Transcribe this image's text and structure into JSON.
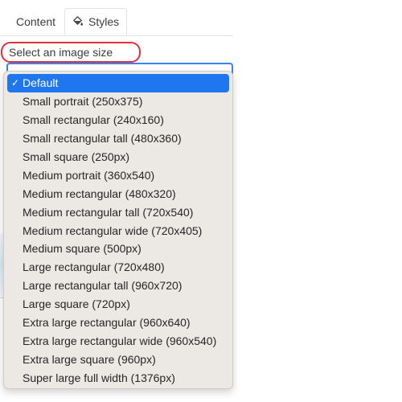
{
  "tabs": [
    {
      "label": "Content",
      "active": false
    },
    {
      "label": "Styles",
      "active": true,
      "icon": "paint-bucket-icon"
    }
  ],
  "field": {
    "label": "Select an image size",
    "highlight_color": "#e0303a"
  },
  "dropdown": {
    "selected_index": 0,
    "check_glyph": "✓",
    "selected_color": "#1f77f0",
    "options": [
      "Default",
      "Small portrait (250x375)",
      "Small rectangular (240x160)",
      "Small rectangular tall (480x360)",
      "Small square (250px)",
      "Medium portrait (360x540)",
      "Medium rectangular (480x320)",
      "Medium rectangular tall (720x540)",
      "Medium rectangular wide (720x405)",
      "Medium square (500px)",
      "Large rectangular (720x480)",
      "Large rectangular tall (960x720)",
      "Large square (720px)",
      "Extra large rectangular (960x640)",
      "Extra large rectangular wide (960x540)",
      "Extra large square (960px)",
      "Super large full width (1376px)"
    ]
  }
}
